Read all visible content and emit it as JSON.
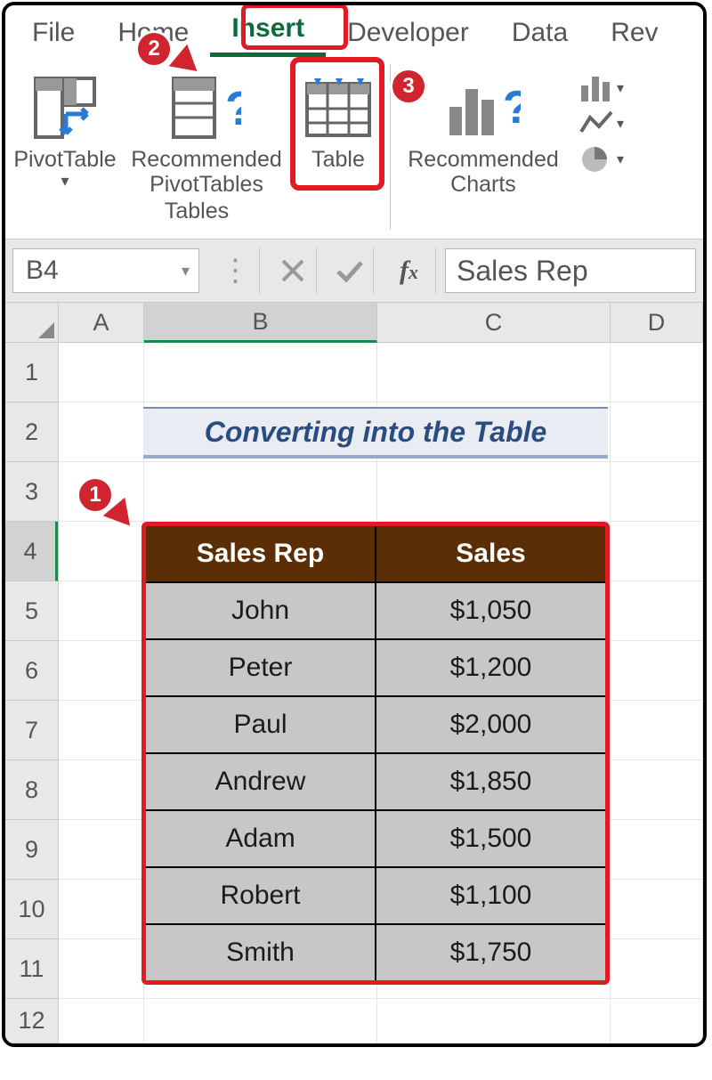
{
  "tabs": {
    "file": "File",
    "home": "Home",
    "insert": "Insert",
    "developer": "Developer",
    "data": "Data",
    "review": "Rev"
  },
  "ribbon": {
    "pivot": "PivotTable",
    "recpivots_l1": "Recommended",
    "recpivots_l2": "PivotTables",
    "table": "Table",
    "reccharts_l1": "Recommended",
    "reccharts_l2": "Charts",
    "tables_group": "Tables"
  },
  "callouts": {
    "c1": "1",
    "c2": "2",
    "c3": "3"
  },
  "fx": {
    "namebox": "B4",
    "value": "Sales Rep"
  },
  "columns": [
    "A",
    "B",
    "C",
    "D"
  ],
  "rows": [
    "1",
    "2",
    "3",
    "4",
    "5",
    "6",
    "7",
    "8",
    "9",
    "10",
    "11",
    "12"
  ],
  "title": "Converting into the Table",
  "table": {
    "headers": [
      "Sales Rep",
      "Sales"
    ],
    "rows": [
      [
        "John",
        "$1,050"
      ],
      [
        "Peter",
        "$1,200"
      ],
      [
        "Paul",
        "$2,000"
      ],
      [
        "Andrew",
        "$1,850"
      ],
      [
        "Adam",
        "$1,500"
      ],
      [
        "Robert",
        "$1,100"
      ],
      [
        "Smith",
        "$1,750"
      ]
    ]
  },
  "chart_data": {
    "type": "table",
    "title": "Converting into the Table",
    "columns": [
      "Sales Rep",
      "Sales"
    ],
    "rows": [
      {
        "Sales Rep": "John",
        "Sales": 1050
      },
      {
        "Sales Rep": "Peter",
        "Sales": 1200
      },
      {
        "Sales Rep": "Paul",
        "Sales": 2000
      },
      {
        "Sales Rep": "Andrew",
        "Sales": 1850
      },
      {
        "Sales Rep": "Adam",
        "Sales": 1500
      },
      {
        "Sales Rep": "Robert",
        "Sales": 1100
      },
      {
        "Sales Rep": "Smith",
        "Sales": 1750
      }
    ]
  }
}
